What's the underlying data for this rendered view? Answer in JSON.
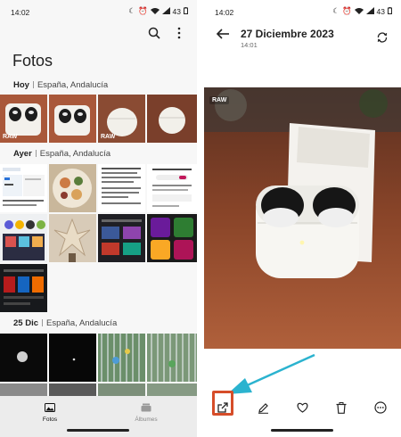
{
  "colors": {
    "highlight": "#d64d29",
    "arrow": "#2bb3cf",
    "text": "#1c1c1c"
  },
  "left": {
    "status": {
      "time": "14:02",
      "battery": "43"
    },
    "icons": [
      "search-icon",
      "more-vertical-icon"
    ],
    "title": "Fotos",
    "sections": [
      {
        "day": "Hoy",
        "location": "España, Andalucía"
      },
      {
        "day": "Ayer",
        "location": "España, Andalucía"
      },
      {
        "day": "25 Dic",
        "location": "España, Andalucía"
      }
    ],
    "raw_badge": "RAW",
    "tabs": [
      {
        "label": "Fotos",
        "icon": "photo-icon",
        "active": true
      },
      {
        "label": "Álbumes",
        "icon": "albums-icon",
        "active": false
      }
    ]
  },
  "right": {
    "status": {
      "time": "14:02",
      "battery": "43"
    },
    "title": "27 Diciembre 2023",
    "subtitle": "14:01",
    "raw_badge": "RAW",
    "actions": [
      "share-icon",
      "edit-icon",
      "favorite-icon",
      "delete-icon",
      "more-icon"
    ]
  }
}
